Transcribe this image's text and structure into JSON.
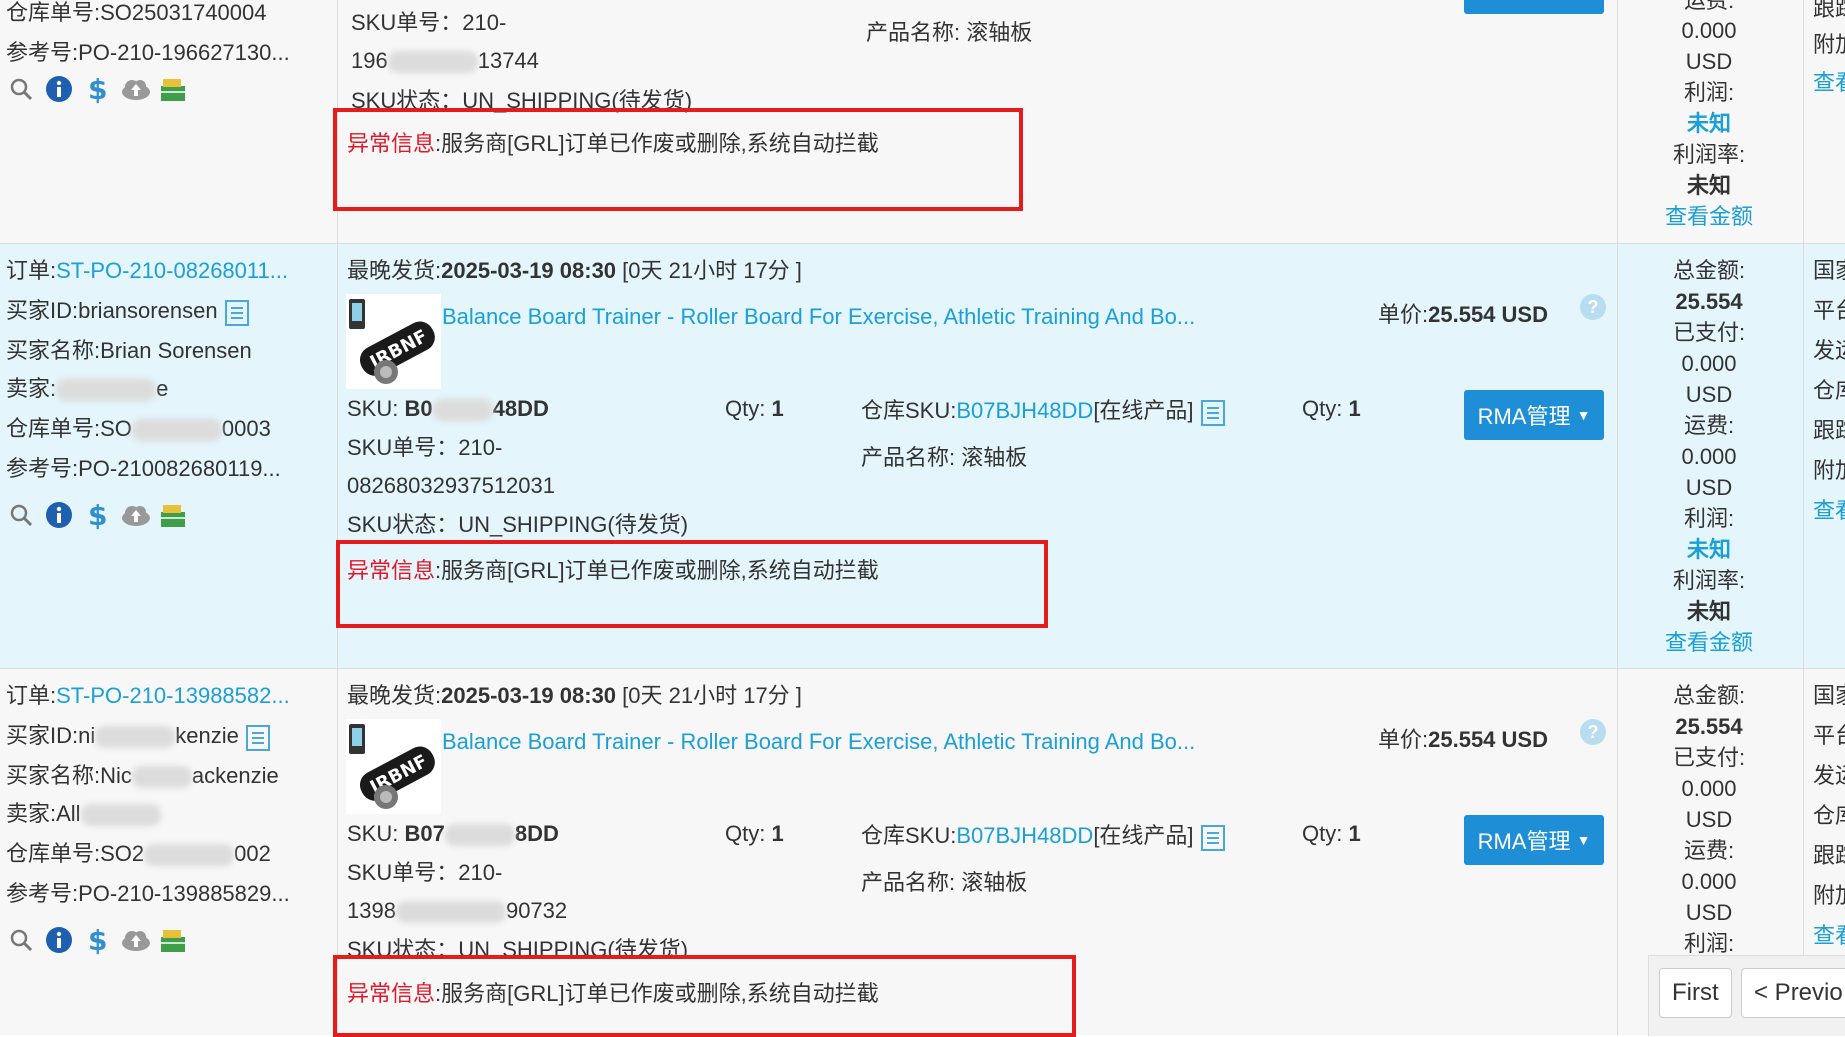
{
  "rows": [
    {
      "warehouse_no": "仓库单号:SO25031740004",
      "ref_no": "参考号:PO-210-196627130...",
      "sku_no_label": "SKU单号：",
      "sku_no_a": "210-",
      "sku_no_b": "196",
      "sku_no_c": "13744",
      "sku_status": "SKU状态：UN_SHIPPING(待发货)",
      "product_name": "产品名称: 滚轴板",
      "error_label": "异常信息",
      "error_text": ":服务商[GRL]订单已作废或删除,系统自动拦截",
      "fin": [
        "运费:",
        "0.000",
        "USD",
        "利润:",
        "未知",
        "利润率:",
        "未知",
        "查看金额"
      ],
      "right_col": [
        "跟踪",
        "附加",
        "查看"
      ]
    },
    {
      "order_label": "订单:",
      "order_no": "ST-PO-210-08268011...",
      "buyer_id_label": "买家ID:",
      "buyer_id": "briansorensen",
      "buyer_name": "买家名称:Brian Sorensen",
      "seller_prefix": "卖家:",
      "seller_suffix": "e",
      "warehouse_prefix": "仓库单号:SO",
      "warehouse_suffix": "0003",
      "ref_prefix": "参考号:PO-210",
      "ref_suffix": "082680119...",
      "latest_ship_label": "最晚发货:",
      "latest_ship_time": "2025-03-19 08:30",
      "countdown": "[0天 21小时 17分 ]",
      "product_title": "Balance Board Trainer - Roller Board For Exercise, Athletic Training And Bo...",
      "price_label": "单价:",
      "price": "25.554 USD",
      "sku_label": "SKU: ",
      "sku_prefix": "B0",
      "sku_suffix": "48DD",
      "qty_label": "Qty: ",
      "qty": "1",
      "wh_sku_label": "仓库SKU:",
      "wh_sku": "B07BJH48DD",
      "online_tag": "[在线产品]",
      "qty2": "1",
      "rma_label": "RMA管理",
      "sku_no_label": "SKU单号：",
      "sku_no_a": "210-",
      "sku_no_b": "08268032937512031",
      "sku_status": "SKU状态：UN_SHIPPING(待发货)",
      "product_name": "产品名称: 滚轴板",
      "error_label": "异常信息",
      "error_text": ":服务商[GRL]订单已作废或删除,系统自动拦截",
      "fin": [
        "总金额:",
        "25.554",
        "已支付:",
        "0.000",
        "USD",
        "运费:",
        "0.000",
        "USD",
        "利润:",
        "未知",
        "利润率:",
        "未知",
        "查看金额"
      ],
      "right_col": [
        "国家",
        "平台",
        "发运",
        "仓库",
        "跟踪",
        "附加",
        "查看"
      ]
    },
    {
      "order_label": "订单:",
      "order_no": "ST-PO-210-13988582...",
      "buyer_id_label": "买家ID:",
      "buyer_id_prefix": "ni",
      "buyer_id_suffix": "kenzie",
      "buyer_name_prefix": "买家名称:Nic",
      "buyer_name_suffix": "ackenzie",
      "seller_prefix": "卖家:All",
      "warehouse_prefix": "仓库单号:SO2",
      "warehouse_suffix": "002",
      "ref_no": "参考号:PO-210-139885829...",
      "latest_ship_label": "最晚发货:",
      "latest_ship_time": "2025-03-19 08:30",
      "countdown": "[0天 21小时 17分 ]",
      "product_title": "Balance Board Trainer - Roller Board For Exercise, Athletic Training And Bo...",
      "price_label": "单价:",
      "price": "25.554 USD",
      "sku_label": "SKU: ",
      "sku_prefix": "B07",
      "sku_suffix": "8DD",
      "qty_label": "Qty: ",
      "qty": "1",
      "wh_sku_label": "仓库SKU:",
      "wh_sku": "B07BJH48DD",
      "online_tag": "[在线产品]",
      "qty2": "1",
      "rma_label": "RMA管理",
      "sku_no_label": "SKU单号：",
      "sku_no_a": "210-",
      "sku_no_b": "1398",
      "sku_no_c": "90732",
      "sku_status": "SKU状态：UN_SHIPPING(待发货)",
      "product_name": "产品名称: 滚轴板",
      "error_label": "异常信息",
      "error_text": ":服务商[GRL]订单已作废或删除,系统自动拦截",
      "fin": [
        "总金额:",
        "25.554",
        "已支付:",
        "0.000",
        "USD",
        "运费:",
        "0.000",
        "USD",
        "利润:"
      ],
      "right_col": [
        "国家",
        "平台",
        "发运",
        "仓库",
        "跟踪",
        "附加",
        "查看"
      ]
    }
  ],
  "pager": {
    "first": "First",
    "prev": "< Previo"
  },
  "colors": {
    "link": "#1a9fd6",
    "error": "#e0182a",
    "button": "#1e8fd6",
    "highlight_row": "#e4f5fb"
  }
}
